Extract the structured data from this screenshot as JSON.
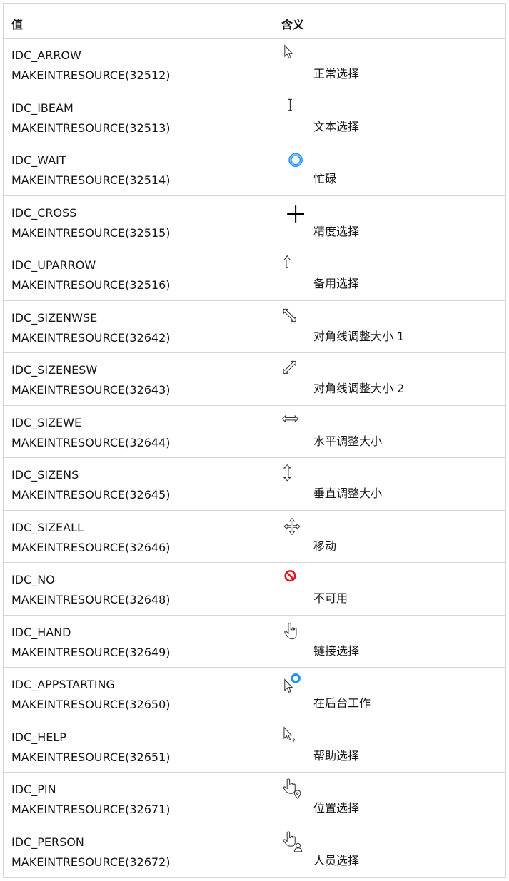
{
  "header": {
    "col_value": "值",
    "col_meaning": "含义"
  },
  "rows": [
    {
      "name": "IDC_ARROW",
      "code": "MAKEINTRESOURCE(32512)",
      "meaning": "正常选择",
      "icon": "arrow-cursor-icon"
    },
    {
      "name": "IDC_IBEAM",
      "code": "MAKEINTRESOURCE(32513)",
      "meaning": "文本选择",
      "icon": "ibeam-cursor-icon"
    },
    {
      "name": "IDC_WAIT",
      "code": "MAKEINTRESOURCE(32514)",
      "meaning": "忙碌",
      "icon": "busy-ring-icon"
    },
    {
      "name": "IDC_CROSS",
      "code": "MAKEINTRESOURCE(32515)",
      "meaning": "精度选择",
      "icon": "crosshair-icon"
    },
    {
      "name": "IDC_UPARROW",
      "code": "MAKEINTRESOURCE(32516)",
      "meaning": "备用选择",
      "icon": "up-arrow-icon"
    },
    {
      "name": "IDC_SIZENWSE",
      "code": "MAKEINTRESOURCE(32642)",
      "meaning": "对角线调整大小 1",
      "icon": "resize-nwse-icon"
    },
    {
      "name": "IDC_SIZENESW",
      "code": "MAKEINTRESOURCE(32643)",
      "meaning": "对角线调整大小 2",
      "icon": "resize-nesw-icon"
    },
    {
      "name": "IDC_SIZEWE",
      "code": "MAKEINTRESOURCE(32644)",
      "meaning": "水平调整大小",
      "icon": "resize-we-icon"
    },
    {
      "name": "IDC_SIZENS",
      "code": "MAKEINTRESOURCE(32645)",
      "meaning": "垂直调整大小",
      "icon": "resize-ns-icon"
    },
    {
      "name": "IDC_SIZEALL",
      "code": "MAKEINTRESOURCE(32646)",
      "meaning": "移动",
      "icon": "move-icon"
    },
    {
      "name": "IDC_NO",
      "code": "MAKEINTRESOURCE(32648)",
      "meaning": "不可用",
      "icon": "not-allowed-icon"
    },
    {
      "name": "IDC_HAND",
      "code": "MAKEINTRESOURCE(32649)",
      "meaning": "链接选择",
      "icon": "hand-pointer-icon"
    },
    {
      "name": "IDC_APPSTARTING",
      "code": "MAKEINTRESOURCE(32650)",
      "meaning": "在后台工作",
      "icon": "arrow-busy-icon"
    },
    {
      "name": "IDC_HELP",
      "code": "MAKEINTRESOURCE(32651)",
      "meaning": "帮助选择",
      "icon": "arrow-help-icon"
    },
    {
      "name": "IDC_PIN",
      "code": "MAKEINTRESOURCE(32671)",
      "meaning": "位置选择",
      "icon": "hand-pin-icon"
    },
    {
      "name": "IDC_PERSON",
      "code": "MAKEINTRESOURCE(32672)",
      "meaning": "人员选择",
      "icon": "hand-person-icon"
    }
  ],
  "colors": {
    "border": "#d6d6d6",
    "text": "#171717",
    "busy_blue": "#1e90ff",
    "no_red": "#e81123"
  }
}
